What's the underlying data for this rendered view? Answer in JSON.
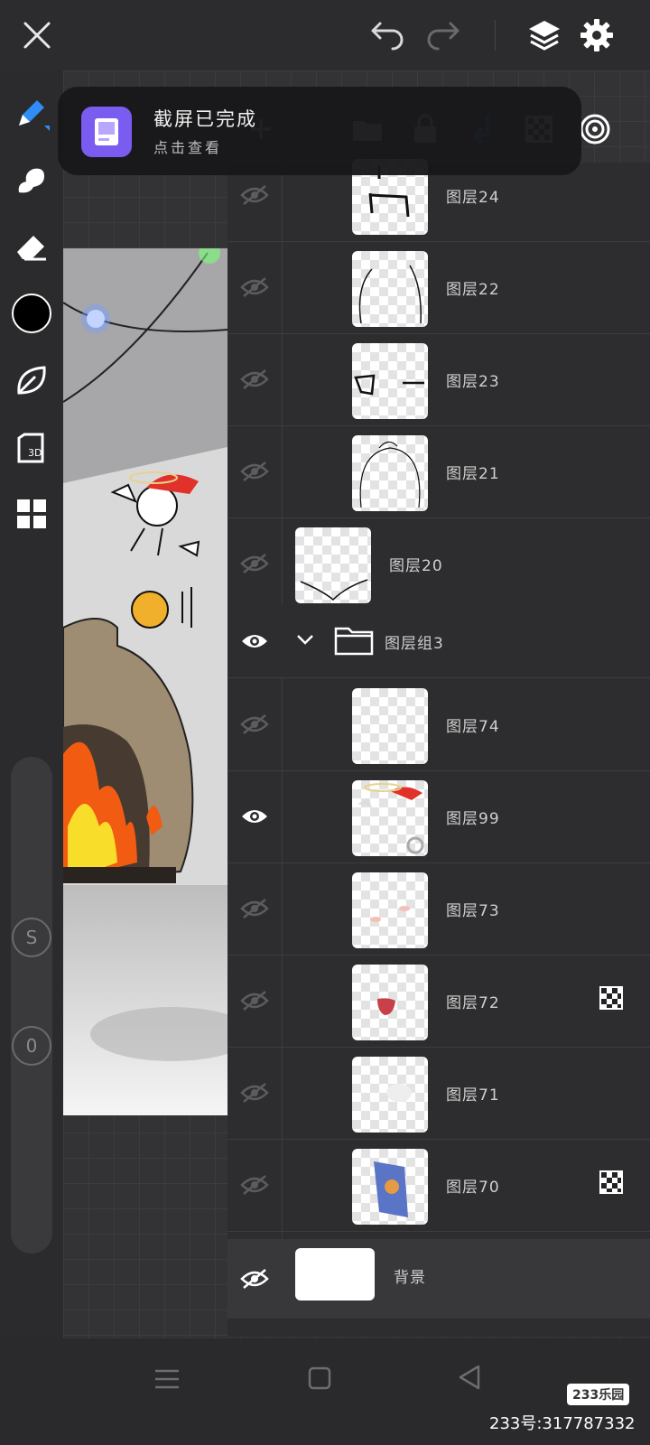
{
  "top_bar": {
    "close_icon": "close-icon",
    "undo_icon": "undo-icon",
    "redo_icon": "redo-icon",
    "layers_icon": "layers-icon",
    "settings_icon": "gear-icon"
  },
  "toolbar": {
    "tools": [
      "brush",
      "smudge",
      "eraser",
      "color",
      "leaf",
      "3d",
      "grid"
    ],
    "color_value": "#000000",
    "size_slider_label": "S",
    "opacity_slider_label": "0"
  },
  "toast": {
    "title": "截屏已完成",
    "subtitle": "点击查看"
  },
  "layer_panel_tools": [
    "add",
    "folder",
    "lock",
    "merge-down",
    "mask",
    "target"
  ],
  "layers": [
    {
      "name": "图层24",
      "visible": false,
      "indent": true,
      "mask": false
    },
    {
      "name": "图层22",
      "visible": false,
      "indent": true,
      "mask": false
    },
    {
      "name": "图层23",
      "visible": false,
      "indent": true,
      "mask": false
    },
    {
      "name": "图层21",
      "visible": false,
      "indent": true,
      "mask": false
    },
    {
      "name": "图层20",
      "visible": false,
      "indent": false,
      "mask": false
    }
  ],
  "group": {
    "name": "图层组3",
    "visible": true,
    "expanded": true
  },
  "group_layers": [
    {
      "name": "图层74",
      "visible": false,
      "mask": false
    },
    {
      "name": "图层99",
      "visible": true,
      "mask": false
    },
    {
      "name": "图层73",
      "visible": false,
      "mask": false
    },
    {
      "name": "图层72",
      "visible": false,
      "mask": true
    },
    {
      "name": "图层71",
      "visible": false,
      "mask": false
    },
    {
      "name": "图层70",
      "visible": false,
      "mask": true
    }
  ],
  "background_layer": {
    "name": "背景",
    "visible": false
  },
  "watermark": {
    "badge": "233乐园",
    "text": "233号:317787332"
  }
}
